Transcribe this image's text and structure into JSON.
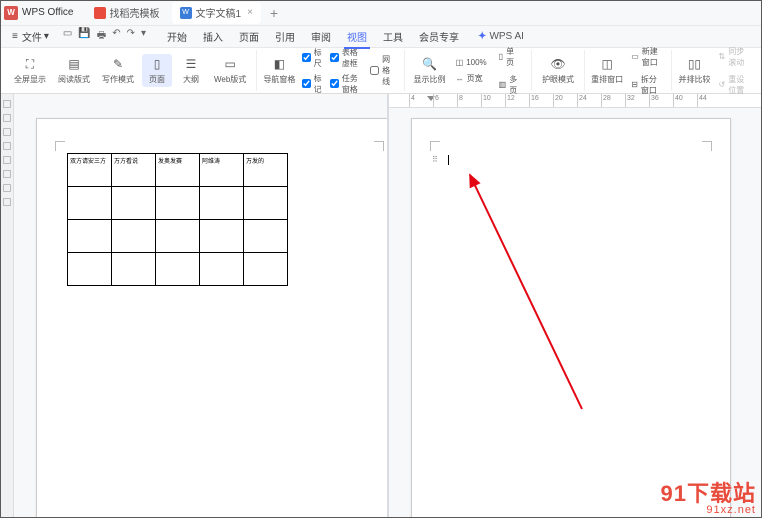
{
  "app": {
    "name": "WPS Office"
  },
  "doc_tabs": [
    {
      "label": "找稻壳模板",
      "icon": "red"
    },
    {
      "label": "文字文稿1",
      "icon": "blue",
      "icon_text": "W",
      "active": true
    }
  ],
  "file_menu": "文件",
  "menu_tabs": {
    "items": [
      "开始",
      "插入",
      "页面",
      "引用",
      "审阅",
      "视图",
      "工具",
      "会员专享"
    ],
    "active_index": 5
  },
  "wps_ai": "WPS AI",
  "ribbon": {
    "view_group": {
      "fullscreen": "全屏显示",
      "read_mode": "阅读版式",
      "write_mode": "写作模式",
      "page_view": "页面",
      "outline": "大纲",
      "web_view": "Web版式"
    },
    "nav_pane": "导航窗格",
    "checks": {
      "ruler": "标尺",
      "markup": "标记",
      "grid_virtual": "表格虚框",
      "task_pane": "任务窗格",
      "gridlines": "网格线"
    },
    "zoom_group": {
      "show_ratio": "显示比例",
      "pct100": "100%",
      "page_width": "页宽",
      "single_page": "单页",
      "multi_page": "多页"
    },
    "eye": "护眼模式",
    "window_group": {
      "arrange": "重排窗口",
      "new_window": "新建窗口",
      "split": "拆分窗口"
    },
    "compare_group": {
      "side_by_side": "并排比较",
      "sync_scroll": "同步滚动",
      "reset_pos": "重设位置"
    }
  },
  "right_ruler": {
    "ticks": [
      "4",
      "6",
      "8",
      "10",
      "12",
      "16",
      "20",
      "24",
      "28",
      "32",
      "36",
      "40",
      "44"
    ]
  },
  "table": {
    "headers": [
      "双方请安三方",
      "万方看说",
      "发奥发赛",
      "阿维涛",
      "万发的"
    ]
  },
  "watermark": {
    "big_prefix": "91",
    "big_text": "下载站",
    "small": "91xz.net"
  }
}
